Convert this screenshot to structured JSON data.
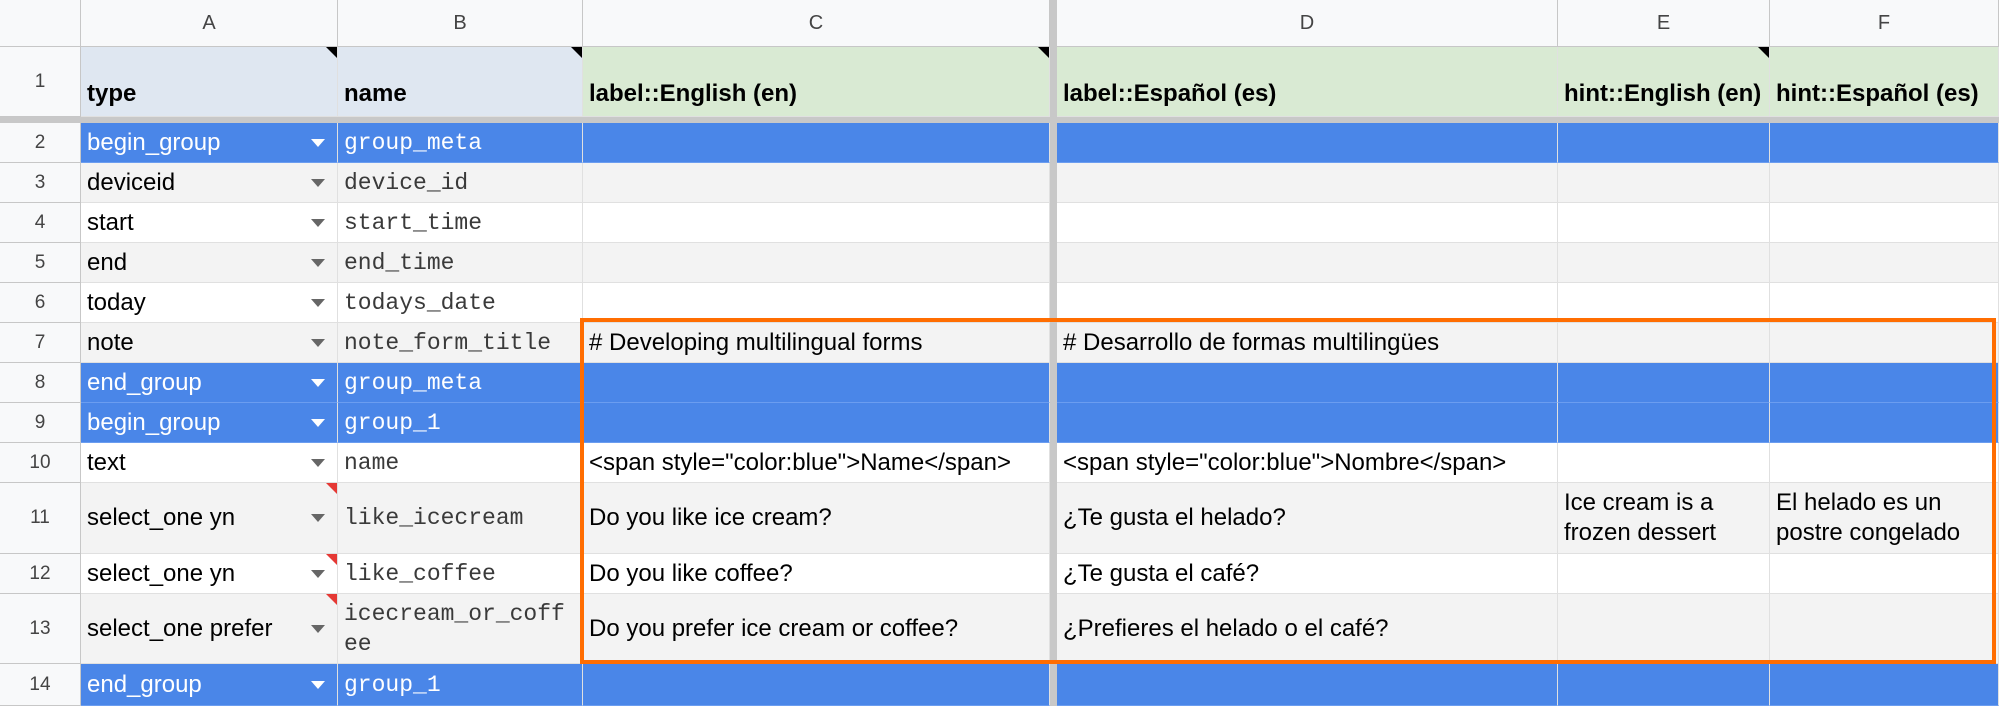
{
  "columns": [
    "A",
    "B",
    "C",
    "D",
    "E",
    "F"
  ],
  "header_row": {
    "number": "1",
    "cells": [
      "type",
      "name",
      "label::English (en)",
      "label::Español (es)",
      "hint::English (en)",
      "hint::Español (es)"
    ]
  },
  "rows": [
    {
      "n": "2",
      "cells": [
        "begin_group",
        "group_meta",
        "",
        "",
        "",
        ""
      ]
    },
    {
      "n": "3",
      "cells": [
        "deviceid",
        "device_id",
        "",
        "",
        "",
        ""
      ]
    },
    {
      "n": "4",
      "cells": [
        "start",
        "start_time",
        "",
        "",
        "",
        ""
      ]
    },
    {
      "n": "5",
      "cells": [
        "end",
        "end_time",
        "",
        "",
        "",
        ""
      ]
    },
    {
      "n": "6",
      "cells": [
        "today",
        "todays_date",
        "",
        "",
        "",
        ""
      ]
    },
    {
      "n": "7",
      "cells": [
        "note",
        "note_form_title",
        "# Developing multilingual forms",
        "# Desarrollo de formas multilingües",
        "",
        ""
      ]
    },
    {
      "n": "8",
      "cells": [
        "end_group",
        "group_meta",
        "",
        "",
        "",
        ""
      ]
    },
    {
      "n": "9",
      "cells": [
        "begin_group",
        "group_1",
        "",
        "",
        "",
        ""
      ]
    },
    {
      "n": "10",
      "cells": [
        "text",
        "name",
        "<span style=\"color:blue\">Name</span>",
        "<span style=\"color:blue\">Nombre</span>",
        "",
        ""
      ]
    },
    {
      "n": "11",
      "cells": [
        "select_one yn",
        "like_icecream",
        "Do you like ice cream?",
        "¿Te gusta el helado?",
        "Ice cream is a frozen dessert",
        "El helado es un postre congelado"
      ]
    },
    {
      "n": "12",
      "cells": [
        "select_one yn",
        "like_coffee",
        "Do you like coffee?",
        "¿Te gusta el café?",
        "",
        ""
      ]
    },
    {
      "n": "13",
      "cells": [
        "select_one prefer",
        "icecream_or_coffee",
        "Do you prefer ice cream or coffee?",
        "¿Prefieres el helado o el café?",
        "",
        ""
      ]
    },
    {
      "n": "14",
      "cells": [
        "end_group",
        "group_1",
        "",
        "",
        "",
        ""
      ]
    }
  ],
  "colors": {
    "group_row": "#4a86e8",
    "header_blue": "#dfe7f1",
    "header_green": "#d9ead3",
    "highlight_border": "#ff6d01",
    "striped_row": "#f3f3f3"
  }
}
